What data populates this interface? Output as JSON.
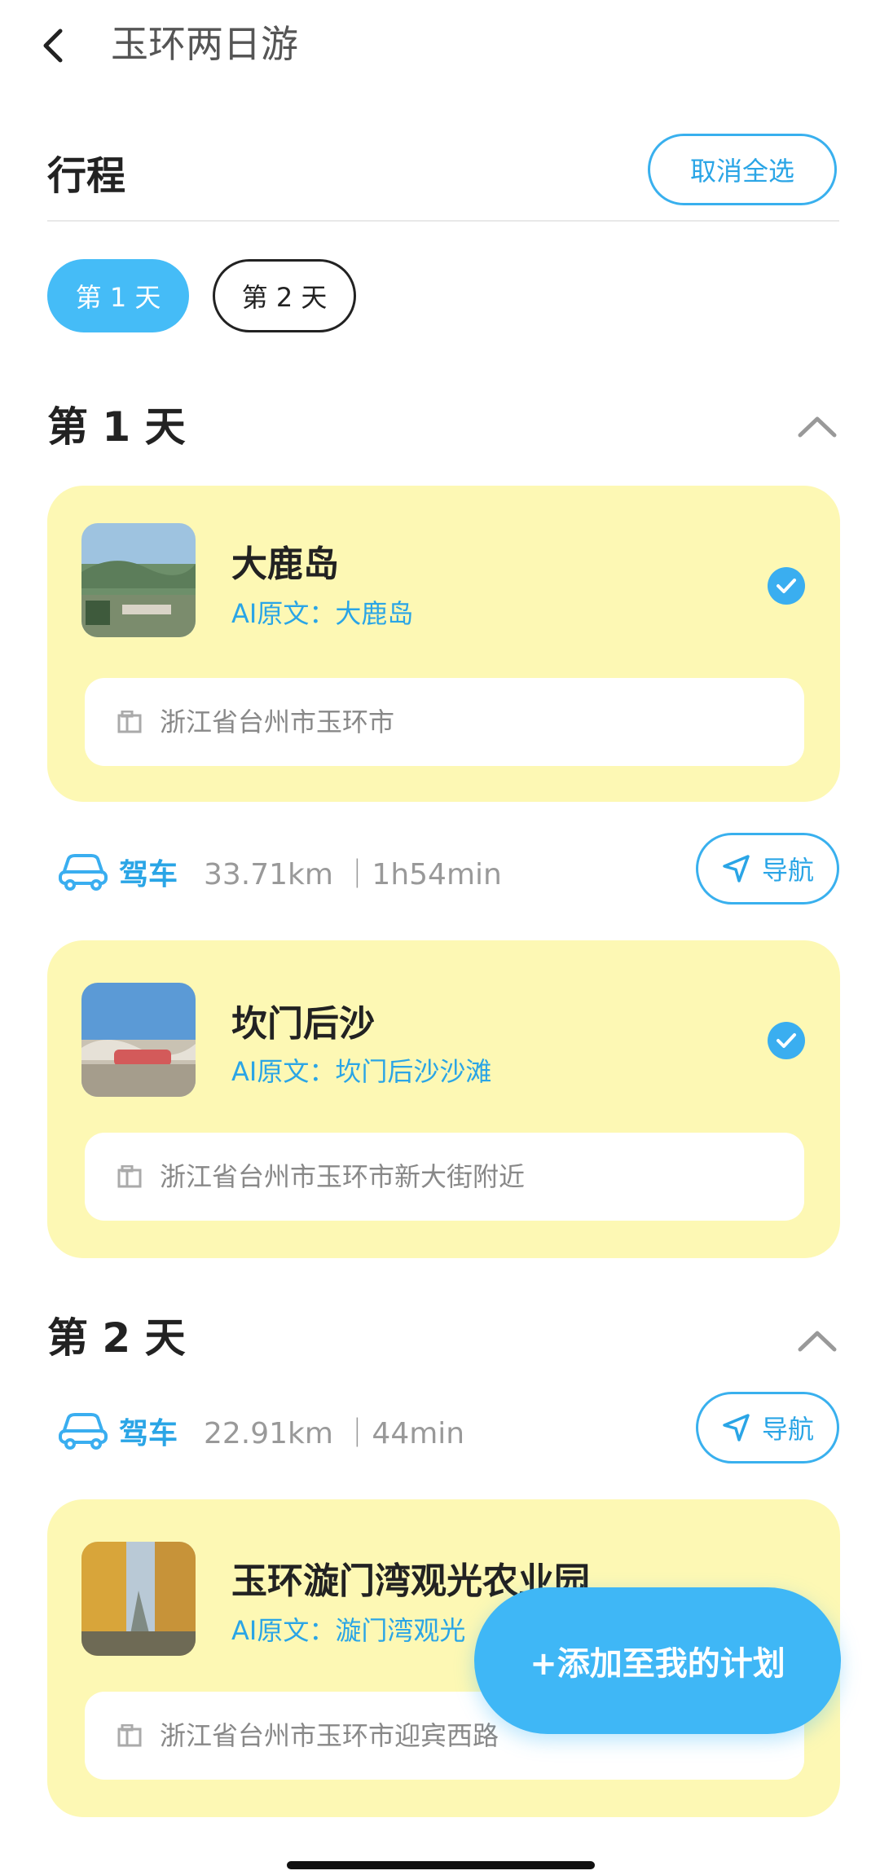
{
  "header": {
    "title": "玉环两日游"
  },
  "itinerary": {
    "title": "行程",
    "deselect_all": "取消全选",
    "tabs": [
      {
        "label": "第 1 天",
        "active": true
      },
      {
        "label": "第 2 天",
        "active": false
      }
    ]
  },
  "days": [
    {
      "heading": "第 1 天",
      "items": [
        {
          "name": "大鹿岛",
          "ai_text": "AI原文：大鹿岛",
          "address": "浙江省台州市玉环市",
          "checked": true
        },
        {
          "name": "坎门后沙",
          "ai_text": "AI原文：坎门后沙沙滩",
          "address": "浙江省台州市玉环市新大街附近",
          "checked": true
        }
      ],
      "route": {
        "mode": "驾车",
        "stats": "33.71km ｜1h54min",
        "nav_label": "导航"
      }
    },
    {
      "heading": "第 2 天",
      "route": {
        "mode": "驾车",
        "stats": "22.91km ｜44min",
        "nav_label": "导航"
      },
      "items": [
        {
          "name": "玉环漩门湾观光农业园",
          "ai_text": "AI原文：漩门湾观光",
          "address": "浙江省台州市玉环市迎宾西路",
          "checked": true
        }
      ]
    }
  ],
  "fab": {
    "label": "+添加至我的计划"
  },
  "colors": {
    "accent": "#45bcf7",
    "card_bg": "#fdf8b4",
    "link": "#2aa5e6"
  }
}
